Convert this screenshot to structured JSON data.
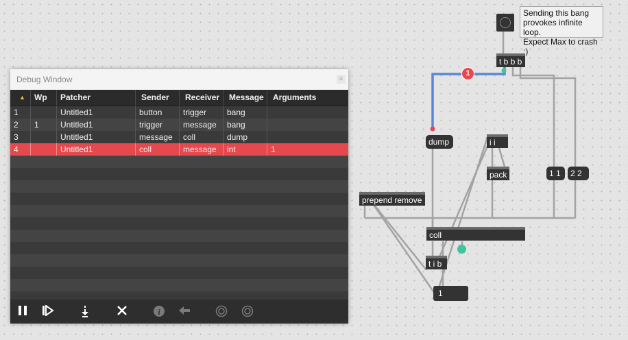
{
  "patcher": {
    "comment_lines": [
      "Sending this bang",
      "provokes infinite loop.",
      "Expect Max to crash :)"
    ],
    "bang_icon": "bang-circle-icon",
    "objects": {
      "trigger_bbb": "t b b b",
      "dump_msg": "dump",
      "unpack_ii": "i i",
      "pack": "pack",
      "msg_11": "1 1",
      "msg_22": "2 2",
      "prepend": "prepend remove",
      "coll": "coll",
      "trigger_ib": "t i b",
      "number_box": "1"
    },
    "error_badge": "1",
    "colors": {
      "selected_wire": "#5b86d6",
      "badge": "#e5484d",
      "teal_outlet": "#3dc4a0"
    }
  },
  "debug_window": {
    "title": "Debug Window",
    "columns": {
      "sort_indicator": "▲",
      "wp": "Wp",
      "patcher": "Patcher",
      "sender": "Sender",
      "receiver": "Receiver",
      "message": "Message",
      "arguments": "Arguments"
    },
    "rows": [
      {
        "n": "1",
        "wp": "",
        "patcher": "Untitled1",
        "sender": "button",
        "receiver": "trigger",
        "message": "bang",
        "arguments": ""
      },
      {
        "n": "2",
        "wp": "1",
        "patcher": "Untitled1",
        "sender": "trigger",
        "receiver": "message",
        "message": "bang",
        "arguments": ""
      },
      {
        "n": "3",
        "wp": "",
        "patcher": "Untitled1",
        "sender": "message",
        "receiver": "coll",
        "message": "dump",
        "arguments": ""
      },
      {
        "n": "4",
        "wp": "",
        "patcher": "Untitled1",
        "sender": "coll",
        "receiver": "message",
        "message": "int",
        "arguments": "1"
      }
    ],
    "selected_row": 4,
    "toolbar": {
      "pause_icon": "pause-icon",
      "step_icon": "step-icon",
      "step_into_icon": "step-into-icon",
      "stop_icon": "stop-icon",
      "info_icon": "info-icon",
      "back_icon": "back-arrow-icon",
      "watch_icon": "watchpoint-icon",
      "watch_all_icon": "watchpoint-all-icon"
    },
    "colors": {
      "selected_row": "#e5484d"
    }
  }
}
